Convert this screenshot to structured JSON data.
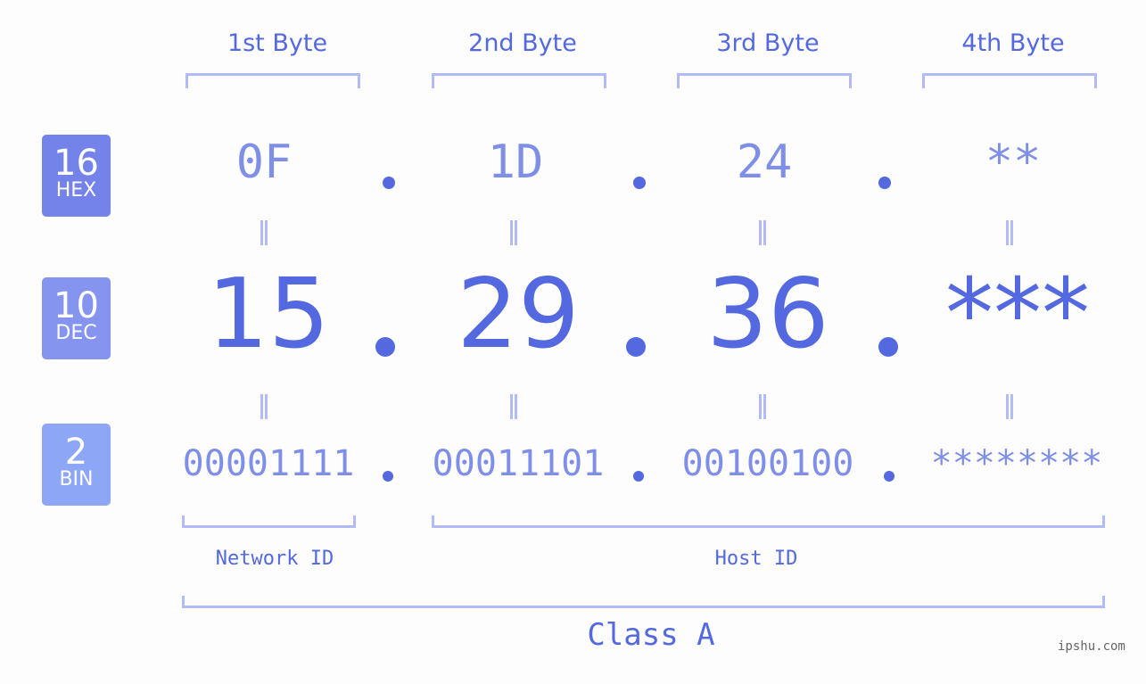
{
  "bytes": [
    {
      "label": "1st Byte",
      "hex": "0F",
      "dec": "15",
      "bin": "00001111"
    },
    {
      "label": "2nd Byte",
      "hex": "1D",
      "dec": "29",
      "bin": "00011101"
    },
    {
      "label": "3rd Byte",
      "hex": "24",
      "dec": "36",
      "bin": "00100100"
    },
    {
      "label": "4th Byte",
      "hex": "**",
      "dec": "***",
      "bin": "********"
    }
  ],
  "badges": {
    "hex": {
      "num": "16",
      "label": "HEX",
      "color": "#7383ea"
    },
    "dec": {
      "num": "10",
      "label": "DEC",
      "color": "#8494ef"
    },
    "bin": {
      "num": "2",
      "label": "BIN",
      "color": "#8ea6f6"
    }
  },
  "sections": {
    "network": "Network ID",
    "host": "Host ID",
    "class": "Class A"
  },
  "watermark": "ipshu.com",
  "colors": {
    "accent": "#5468e0",
    "light": "#7f8fe8",
    "bracket": "#b2bbf6"
  }
}
